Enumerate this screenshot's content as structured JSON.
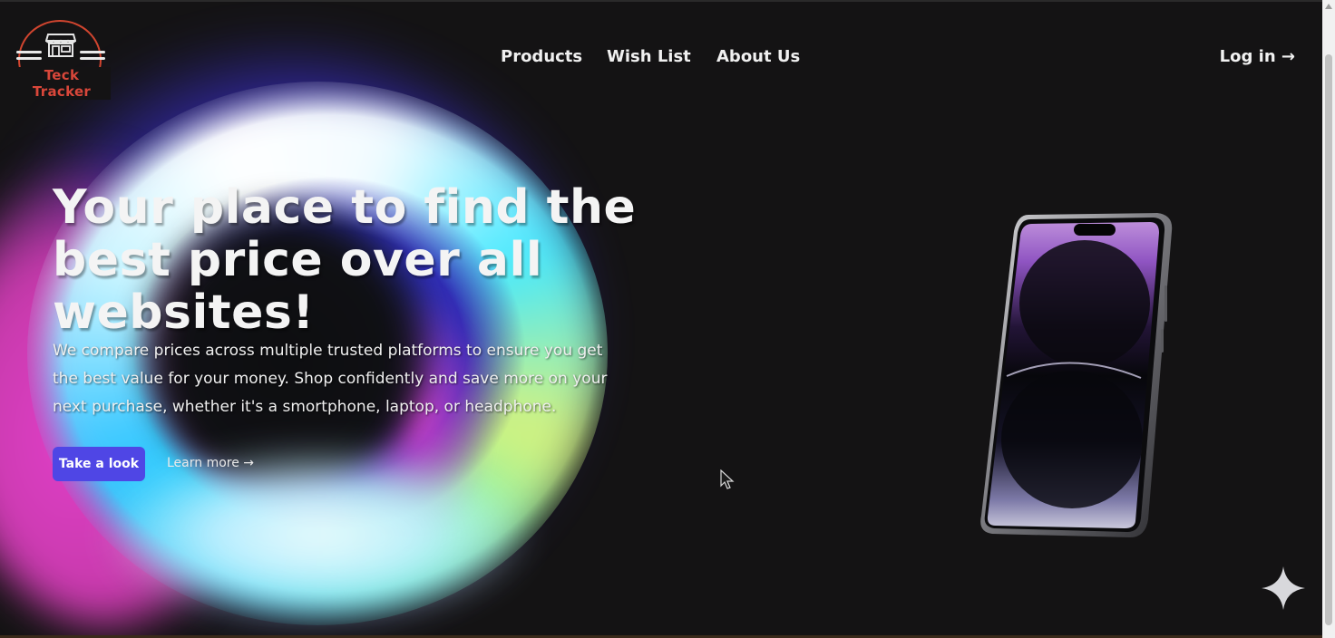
{
  "brand": {
    "name": "Teck Tracker",
    "accent_color": "#d9473a"
  },
  "nav": {
    "items": [
      {
        "label": "Products"
      },
      {
        "label": "Wish List"
      },
      {
        "label": "About Us"
      }
    ],
    "login_label": "Log in →"
  },
  "hero": {
    "title": "Your place to find the best price over all websites!",
    "description": "We compare prices across multiple trusted platforms to ensure you get the best value for your money. Shop confidently and save more on your next purchase, whether it's a smortphone, laptop, or headphone.",
    "primary_button": "Take a look",
    "secondary_link": "Learn more →",
    "button_color": "#4f46e5"
  },
  "icons": {
    "logo": "store-icon",
    "cursor": "mouse-cursor-icon",
    "sparkle": "sparkle-icon",
    "product": "smartphone-image"
  }
}
